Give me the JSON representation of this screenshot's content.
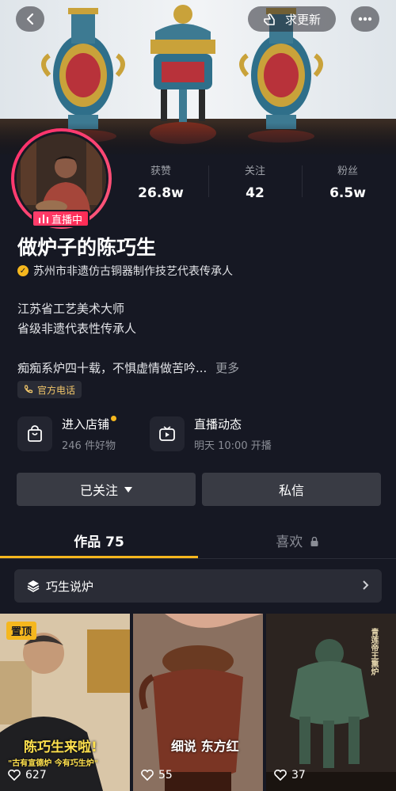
{
  "header": {
    "update_label": "求更新"
  },
  "profile": {
    "live_label": "直播中",
    "name": "做炉子的陈巧生",
    "verification": "苏州市非遗仿古铜器制作技艺代表传承人",
    "stats": [
      {
        "label": "获赞",
        "value": "26.8w"
      },
      {
        "label": "关注",
        "value": "42"
      },
      {
        "label": "粉丝",
        "value": "6.5w"
      }
    ],
    "bio_lines": [
      "江苏省工艺美术大师",
      "省级非遗代表性传承人"
    ],
    "bio_excerpt": "痴痴系炉四十载，不惧虚情做苦吟...",
    "more_label": "更多",
    "phone_label": "官方电话"
  },
  "entries": {
    "shop": {
      "title": "进入店铺",
      "subtitle": "246 件好物"
    },
    "live": {
      "title": "直播动态",
      "subtitle": "明天 10:00 开播"
    }
  },
  "actions": {
    "follow_label": "已关注",
    "message_label": "私信"
  },
  "tabs": {
    "works_label": "作品 75",
    "likes_label": "喜欢"
  },
  "collection": {
    "label": "巧生说炉"
  },
  "videos": [
    {
      "likes": "627",
      "pinned_label": "置顶",
      "caption": "陈巧生来啦!",
      "subcaption": "\"古有宣德炉 今有巧生炉\""
    },
    {
      "likes": "55",
      "caption": "细说 东方红"
    },
    {
      "likes": "37",
      "caption": "青莲帝王熏炉"
    }
  ],
  "colors": {
    "background": "#161823",
    "accent_yellow": "#f5b71e",
    "live_pink": "#ff2c55",
    "button_gray": "#393b44"
  },
  "icons": [
    "back-arrow-icon",
    "hand-point-icon",
    "more-dots-icon",
    "live-bars-icon",
    "verified-icon",
    "phone-icon",
    "shopping-bag-icon",
    "tv-play-icon",
    "caret-down-icon",
    "lock-icon",
    "layers-icon",
    "chevron-right-icon",
    "heart-icon"
  ]
}
